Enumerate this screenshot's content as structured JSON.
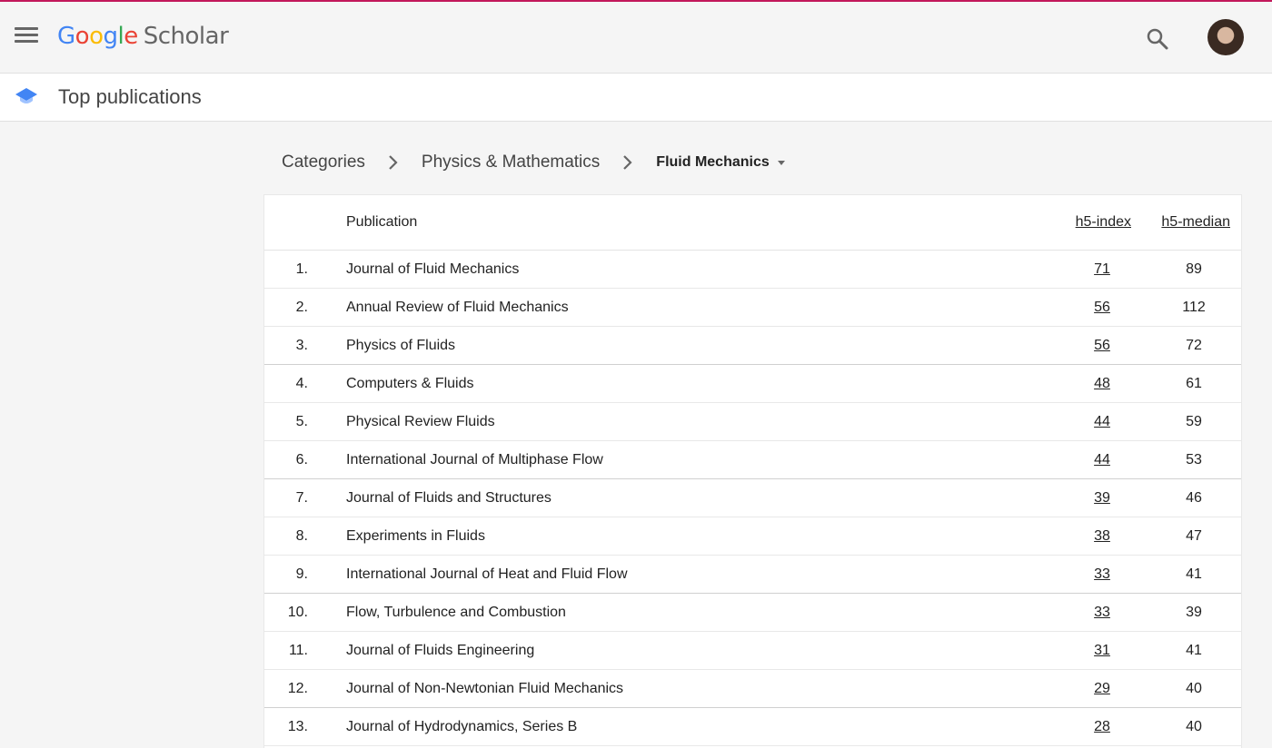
{
  "app": {
    "logo_google": "Google",
    "logo_scholar": "Scholar"
  },
  "header": {
    "subtitle": "Top publications"
  },
  "breadcrumb": {
    "items": [
      "Categories",
      "Physics & Mathematics"
    ],
    "current": "Fluid Mechanics"
  },
  "table": {
    "headers": {
      "publication": "Publication",
      "h5_index": "h5-index",
      "h5_median": "h5-median"
    },
    "rows": [
      {
        "rank": "1.",
        "publication": "Journal of Fluid Mechanics",
        "h5_index": "71",
        "h5_median": "89"
      },
      {
        "rank": "2.",
        "publication": "Annual Review of Fluid Mechanics",
        "h5_index": "56",
        "h5_median": "112"
      },
      {
        "rank": "3.",
        "publication": "Physics of Fluids",
        "h5_index": "56",
        "h5_median": "72"
      },
      {
        "rank": "4.",
        "publication": "Computers & Fluids",
        "h5_index": "48",
        "h5_median": "61"
      },
      {
        "rank": "5.",
        "publication": "Physical Review Fluids",
        "h5_index": "44",
        "h5_median": "59"
      },
      {
        "rank": "6.",
        "publication": "International Journal of Multiphase Flow",
        "h5_index": "44",
        "h5_median": "53"
      },
      {
        "rank": "7.",
        "publication": "Journal of Fluids and Structures",
        "h5_index": "39",
        "h5_median": "46"
      },
      {
        "rank": "8.",
        "publication": "Experiments in Fluids",
        "h5_index": "38",
        "h5_median": "47"
      },
      {
        "rank": "9.",
        "publication": "International Journal of Heat and Fluid Flow",
        "h5_index": "33",
        "h5_median": "41"
      },
      {
        "rank": "10.",
        "publication": "Flow, Turbulence and Combustion",
        "h5_index": "33",
        "h5_median": "39"
      },
      {
        "rank": "11.",
        "publication": "Journal of Fluids Engineering",
        "h5_index": "31",
        "h5_median": "41"
      },
      {
        "rank": "12.",
        "publication": "Journal of Non-Newtonian Fluid Mechanics",
        "h5_index": "29",
        "h5_median": "40"
      },
      {
        "rank": "13.",
        "publication": "Journal of Hydrodynamics, Series B",
        "h5_index": "28",
        "h5_median": "40"
      }
    ]
  },
  "icons": {
    "menu": "menu-icon",
    "search": "search-icon",
    "cap": "graduation-cap-icon",
    "avatar": "avatar"
  },
  "colors": {
    "accent_line": "#c2185b",
    "cap_blue": "#4285f4"
  }
}
